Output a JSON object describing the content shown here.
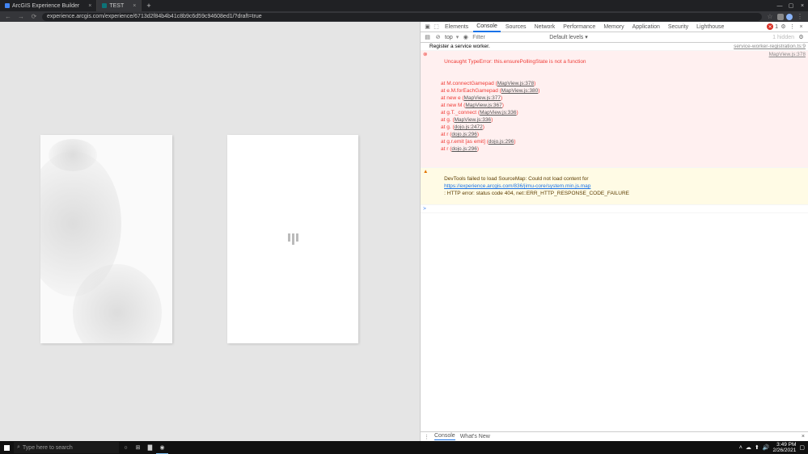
{
  "browser": {
    "tabs": [
      {
        "title": "ArcGIS Experience Builder"
      },
      {
        "title": "TEST"
      }
    ],
    "url": "experience.arcgis.com/experience/6713d2f84b4b41c8b9c6d59c94608ed1/?draft=true"
  },
  "devtools": {
    "tabs": [
      "Elements",
      "Console",
      "Sources",
      "Network",
      "Performance",
      "Memory",
      "Application",
      "Security",
      "Lighthouse"
    ],
    "activeTab": "Console",
    "errorCount": "1",
    "toolbar": {
      "context": "top",
      "filter_placeholder": "Filter",
      "levels": "Default levels ▾",
      "hidden": "1 hidden"
    },
    "logs": {
      "info1": {
        "msg": "Register a service worker.",
        "src": "service-worker-registration.ts:9"
      },
      "error": {
        "msg": "Uncaught TypeError: this.ensurePollingState is not a function",
        "src": "MapView.js:378",
        "stack": [
          {
            "pre": "at M.connectGamepad (",
            "link": "MapView.js:378",
            "post": ")"
          },
          {
            "pre": "at e.M.forEachGamepad (",
            "link": "MapView.js:380",
            "post": ")"
          },
          {
            "pre": "at new e (",
            "link": "MapView.js:377",
            "post": ")"
          },
          {
            "pre": "at new M (",
            "link": "MapView.js:367",
            "post": ")"
          },
          {
            "pre": "at g.T._connect (",
            "link": "MapView.js:336",
            "post": ")"
          },
          {
            "pre": "at g.<anonymous> (",
            "link": "MapView.js:336",
            "post": ")"
          },
          {
            "pre": "at g.<anonymous> (",
            "link": "dojo.js:2472",
            "post": ")"
          },
          {
            "pre": "at r (",
            "link": "dojo.js:296",
            "post": ")"
          },
          {
            "pre": "at g.r.emit [as emit] (",
            "link": "dojo.js:296",
            "post": ")"
          },
          {
            "pre": "at r (",
            "link": "dojo.js:296",
            "post": ")"
          }
        ]
      },
      "warn": {
        "pre": "DevTools failed to load SourceMap: Could not load content for ",
        "link": "https://experience.arcgis.com/836/jimu-core/system.min.js.map",
        "post": ": HTTP error: status code 404, net::ERR_HTTP_RESPONSE_CODE_FAILURE"
      },
      "prompt": ">"
    },
    "drawer": {
      "tabs": [
        "Console",
        "What's New"
      ]
    }
  },
  "taskbar": {
    "search_placeholder": "Type here to search",
    "time": "3:49 PM",
    "date": "2/26/2021"
  }
}
